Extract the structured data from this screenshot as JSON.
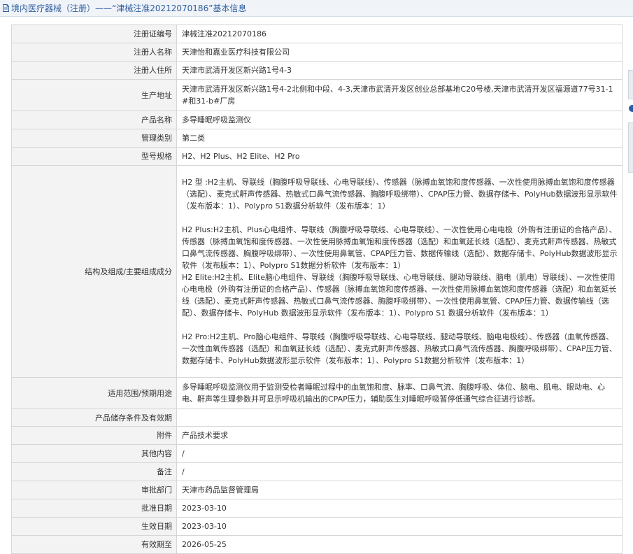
{
  "header": {
    "icon": "document-icon",
    "title": "境内医疗器械（注册）——“津械注准20212070186”基本信息"
  },
  "rows": [
    {
      "label": "注册证编号",
      "value": "津械注准20212070186"
    },
    {
      "label": "注册人名称",
      "value": "天津怡和嘉业医疗科技有限公司"
    },
    {
      "label": "注册人住所",
      "value": "天津市武清开发区新兴路1号4-3"
    },
    {
      "label": "生产地址",
      "value": "天津市武清开发区新兴路1号4-2北侧和中段、4-3,天津市武清开发区创业总部基地C20号楼,天津市武清开发区福源道77号31-1#和31-b#厂房"
    },
    {
      "label": "产品名称",
      "value": "多导睡眠呼吸监测仪"
    },
    {
      "label": "管理类别",
      "value": "第二类"
    },
    {
      "label": "型号规格",
      "value": "H2、H2 Plus、H2 Elite、H2 Pro"
    },
    {
      "label": "结构及组成/主要组成成分",
      "paragraphs": [
        "H2 型 :H2主机、导联线（胸腹呼吸导联线、心电导联线）、传感器（脉搏血氧饱和度传感器、一次性使用脉搏血氧饱和度传感器（选配）、麦克式鼾声传感器、热敏式口鼻气流传感器、胸腹呼吸绑带）、CPAP压力管、数据存储卡、PolyHub数据波形显示软件（发布版本：1）、Polypro S1数据分析软件（发布版本：1）",
        "",
        "H2 Plus:H2主机、Plus心电组件、导联线（胸腹呼吸导联线、心电导联线）、一次性使用心电电极（外购有注册证的合格产品）、传感器（脉搏血氧饱和度传感器、一次性使用脉搏血氧饱和度传感器（选配）和血氧延长线（选配）、麦克式鼾声传感器、热敏式口鼻气流传感器、胸腹呼吸绑带）、一次性使用鼻氧管、CPAP压力管、数据传输线（选配）、数据存储卡、PolyHub数据波形显示软件（发布版本：1）、Polypro S1数据分析软件（发布版本：1）",
        "H2 Elite:H2主机、Elite脑心电组件、导联线（胸腹呼吸导联线、心电导联线、腿动导联线、脑电（肌电）导联线）、一次性使用心电电极（外购有注册证的合格产品）、传感器（脉搏血氧饱和度传感器、一次性使用脉搏血氧饱和度传感器（选配）和血氧延长线（选配）、麦克式鼾声传感器、热敏式口鼻气流传感器、胸腹呼吸绑带）、一次性使用鼻氧管、CPAP压力管、数据传输线（选配）、数据存储卡、PolyHub 数据波形显示软件（发布版本：1）、Polypro S1 数据分析软件（发布版本：1）",
        "",
        "H2 Pro:H2主机、Pro脑心电组件、导联线（胸腹呼吸导联线、心电导联线、腿动导联线、脑电电极线）、传感器（血氧传感器、一次性血氧传感器（选配）和血氧延长线（选配）、麦克式鼾声传感器、热敏式口鼻气流传感器、胸腹呼吸绑带）、CPAP压力管、数据存储卡、PolyHub数据波形显示软件（发布版本：1）、Polypro S1数据分析软件（发布版本：1）"
      ]
    },
    {
      "label": "适用范围/预期用途",
      "value": "多导睡眠呼吸监测仪用于监测受检者睡眠过程中的血氧饱和度、脉率、口鼻气流、胸腹呼吸、体位、脑电、肌电、眼动电、心电、鼾声等生理参数并可显示呼吸机输出的CPAP压力，辅助医生对睡眠呼吸暂停低通气综合征进行诊断。"
    },
    {
      "label": "产品储存条件及有效期",
      "value": ""
    },
    {
      "label": "附件",
      "value": "产品技术要求"
    },
    {
      "label": "其他内容",
      "value": "/"
    },
    {
      "label": "备注",
      "value": "/"
    },
    {
      "label": "审批部门",
      "value": "天津市药品监督管理局"
    },
    {
      "label": "批准日期",
      "value": "2023-03-10"
    },
    {
      "label": "生效日期",
      "value": "2023-03-10"
    },
    {
      "label": "有效期至",
      "value": "2026-05-25"
    }
  ]
}
